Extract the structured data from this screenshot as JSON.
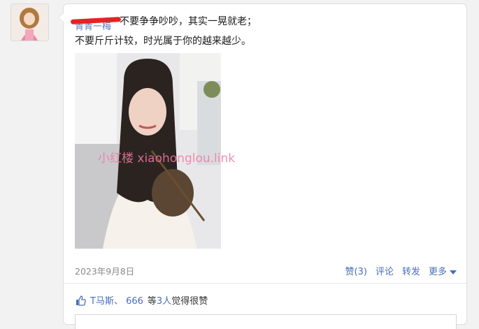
{
  "post": {
    "author": "青青一梅",
    "line1": "不要争争吵吵，其实一晃就老；",
    "line2": "不要斤斤计较，时光属于你的越来越少。",
    "watermark": "小红楼 xiaohonglou.link",
    "date": "2023年9月8日"
  },
  "actions": {
    "like": "赞(3)",
    "comment": "评论",
    "share": "转发",
    "more": "更多"
  },
  "likes": {
    "names": "T马斯、 666",
    "deng": "等",
    "count": "3人",
    "suffix": "觉得很赞"
  }
}
